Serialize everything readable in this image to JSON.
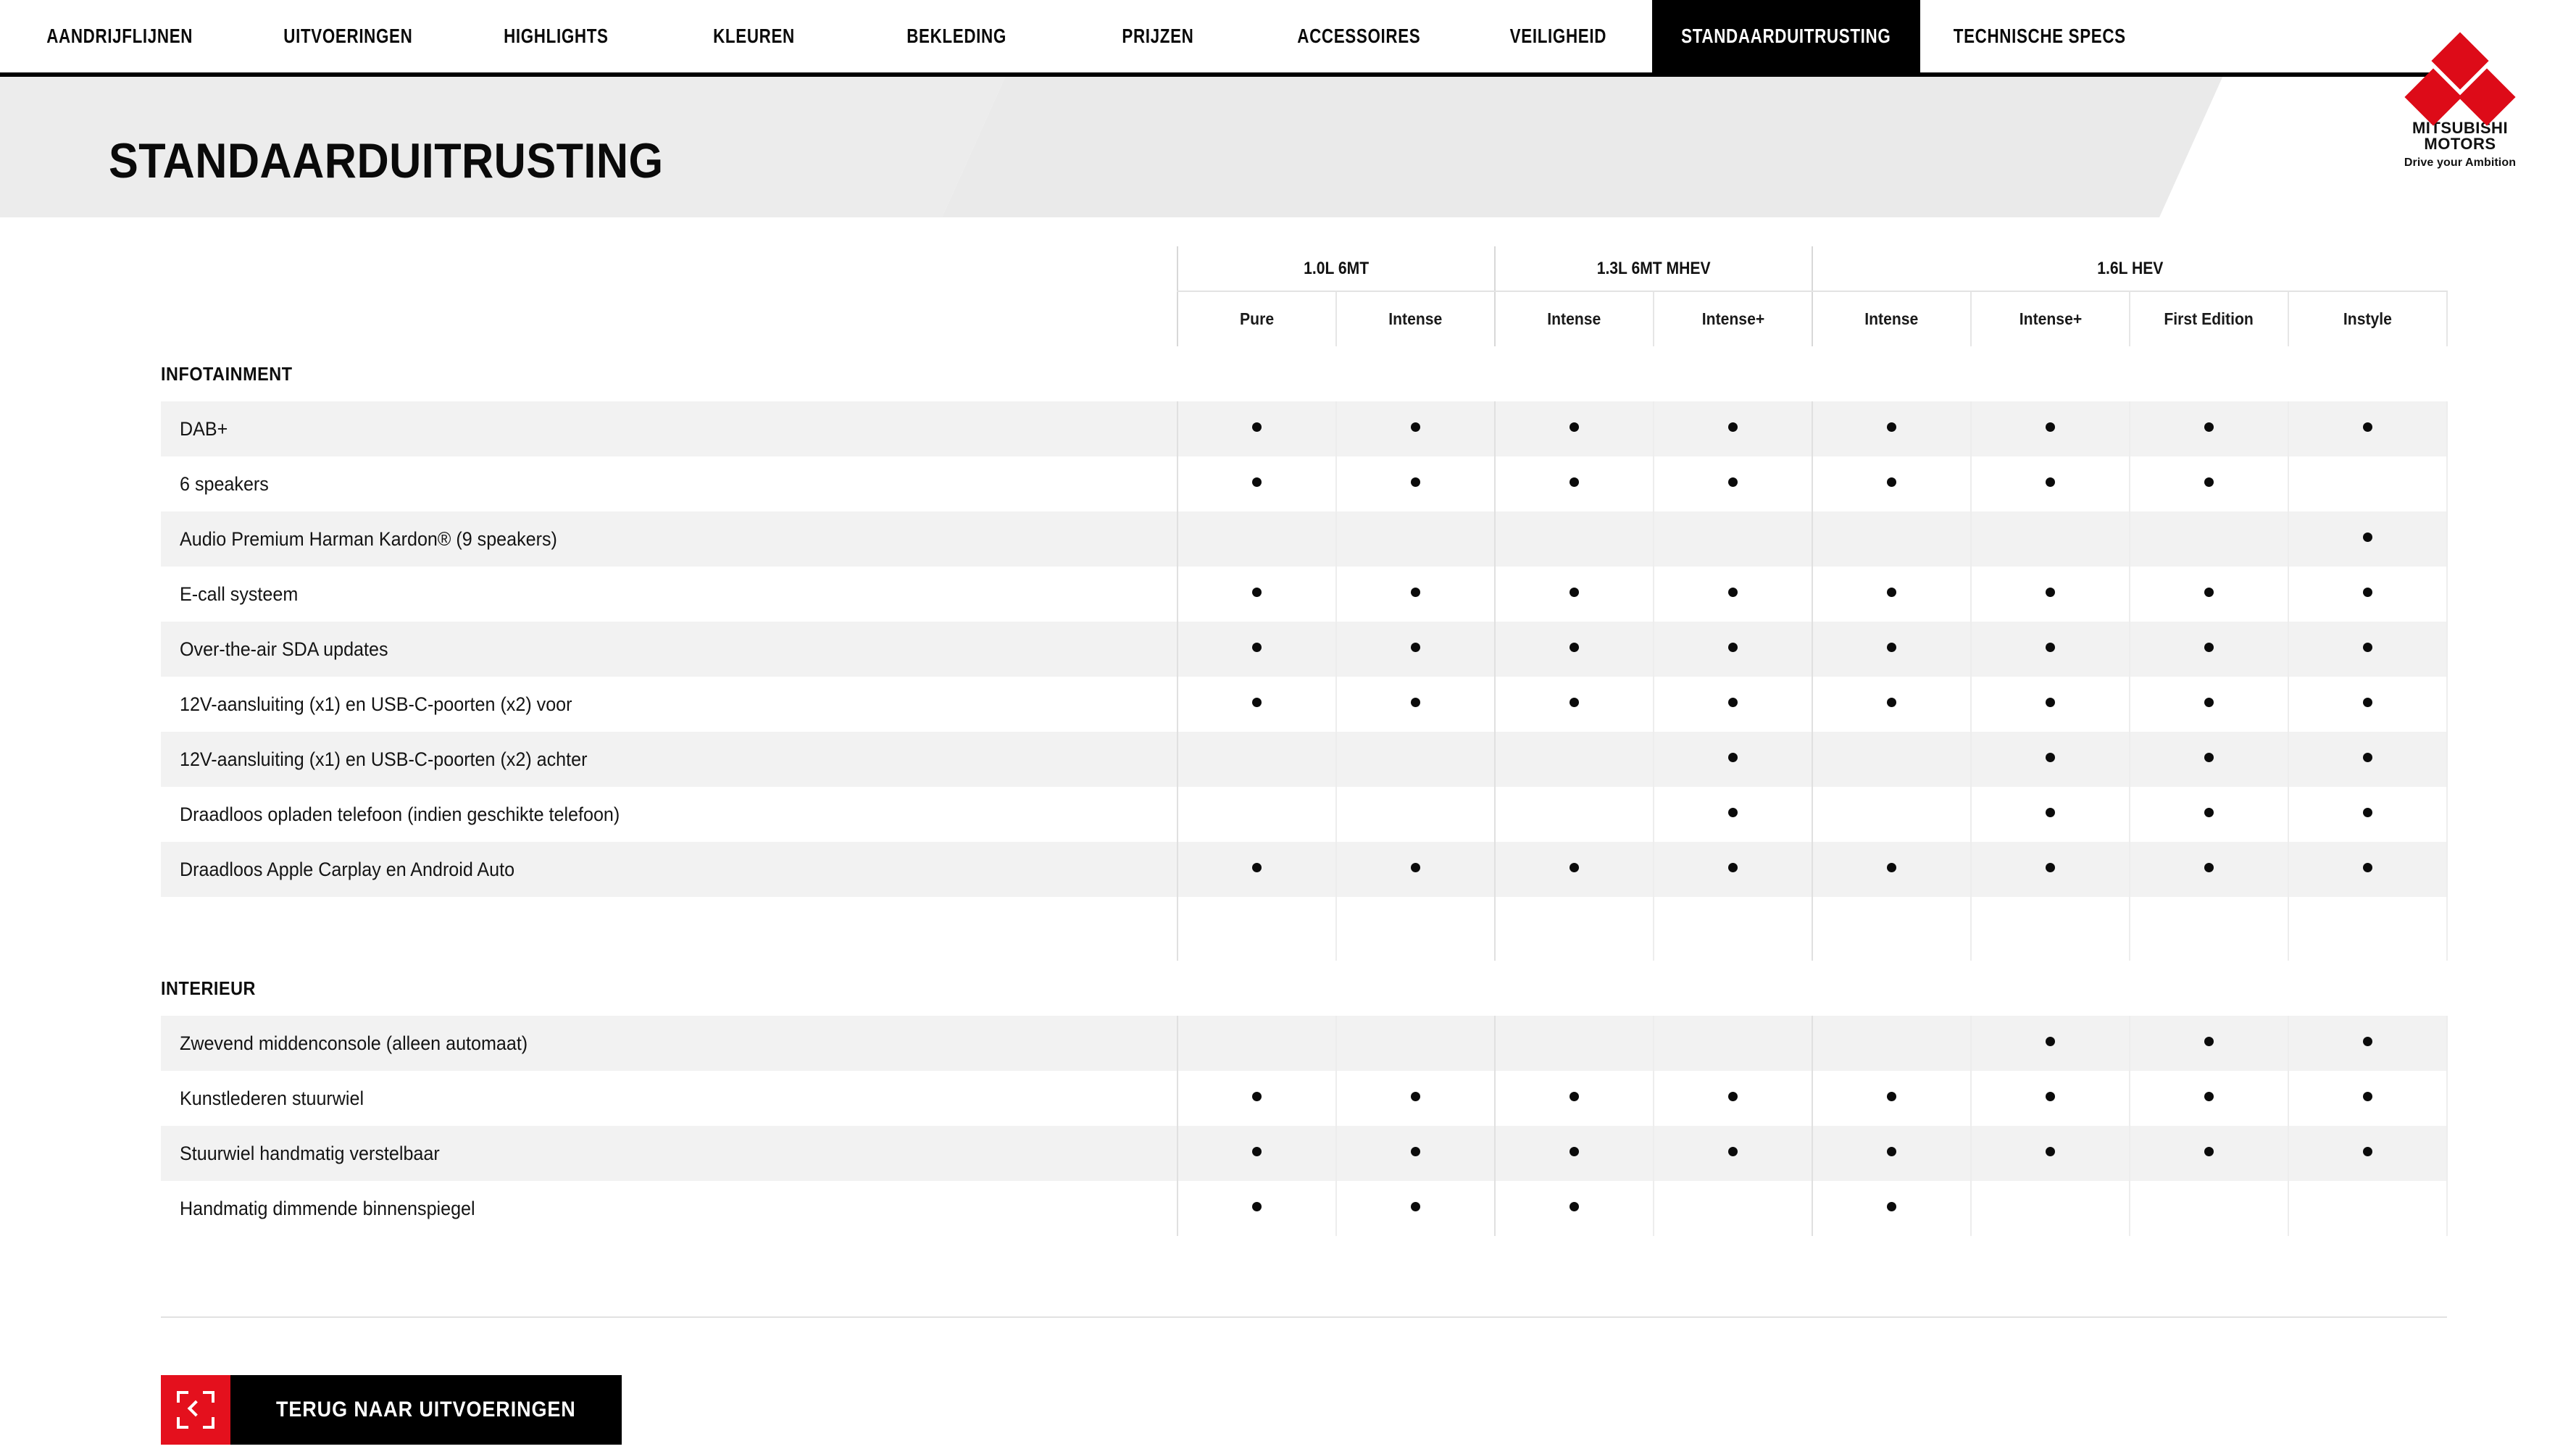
{
  "nav": {
    "items": [
      {
        "label": "AANDRIJFLIJNEN",
        "active": false
      },
      {
        "label": "UITVOERINGEN",
        "active": false
      },
      {
        "label": "HIGHLIGHTS",
        "active": false
      },
      {
        "label": "KLEUREN",
        "active": false
      },
      {
        "label": "BEKLEDING",
        "active": false
      },
      {
        "label": "PRIJZEN",
        "active": false
      },
      {
        "label": "ACCESSOIRES",
        "active": false
      },
      {
        "label": "VEILIGHEID",
        "active": false
      },
      {
        "label": "STANDAARDUITRUSTING",
        "active": true
      },
      {
        "label": "TECHNISCHE SPECS",
        "active": false
      }
    ]
  },
  "brand": {
    "name_line1": "MITSUBISHI",
    "name_line2": "MOTORS",
    "tagline": "Drive your Ambition",
    "accent_color": "#dd0b18"
  },
  "header": {
    "title": "STANDAARDUITRUSTING"
  },
  "table": {
    "engine_groups": [
      {
        "label": "1.0L 6MT",
        "span": 2
      },
      {
        "label": "1.3L 6MT MHEV",
        "span": 2
      },
      {
        "label": "1.6L HEV",
        "span": 4
      }
    ],
    "trims": [
      "Pure",
      "Intense",
      "Intense",
      "Intense+",
      "Intense",
      "Intense+",
      "First Edition",
      "Instyle"
    ],
    "sections": [
      {
        "title": "INFOTAINMENT",
        "rows": [
          {
            "label": "DAB+",
            "values": [
              true,
              true,
              true,
              true,
              true,
              true,
              true,
              true
            ]
          },
          {
            "label": "6 speakers",
            "values": [
              true,
              true,
              true,
              true,
              true,
              true,
              true,
              false
            ]
          },
          {
            "label": "Audio Premium Harman Kardon® (9 speakers)",
            "values": [
              false,
              false,
              false,
              false,
              false,
              false,
              false,
              true
            ]
          },
          {
            "label": "E-call systeem",
            "values": [
              true,
              true,
              true,
              true,
              true,
              true,
              true,
              true
            ]
          },
          {
            "label": "Over-the-air SDA updates",
            "values": [
              true,
              true,
              true,
              true,
              true,
              true,
              true,
              true
            ]
          },
          {
            "label": "12V-aansluiting (x1) en USB-C-poorten (x2) voor",
            "values": [
              true,
              true,
              true,
              true,
              true,
              true,
              true,
              true
            ]
          },
          {
            "label": "12V-aansluiting (x1) en USB-C-poorten (x2) achter",
            "values": [
              false,
              false,
              false,
              true,
              false,
              true,
              true,
              true
            ]
          },
          {
            "label": "Draadloos opladen telefoon (indien geschikte telefoon)",
            "values": [
              false,
              false,
              false,
              true,
              false,
              true,
              true,
              true
            ]
          },
          {
            "label": "Draadloos Apple Carplay en Android Auto",
            "values": [
              true,
              true,
              true,
              true,
              true,
              true,
              true,
              true
            ]
          }
        ]
      },
      {
        "title": "INTERIEUR",
        "rows": [
          {
            "label": "Zwevend middenconsole (alleen automaat)",
            "values": [
              false,
              false,
              false,
              false,
              false,
              true,
              true,
              true
            ]
          },
          {
            "label": "Kunstlederen stuurwiel",
            "values": [
              true,
              true,
              true,
              true,
              true,
              true,
              true,
              true
            ]
          },
          {
            "label": "Stuurwiel handmatig verstelbaar",
            "values": [
              true,
              true,
              true,
              true,
              true,
              true,
              true,
              true
            ]
          },
          {
            "label": "Handmatig dimmende binnenspiegel",
            "values": [
              true,
              true,
              true,
              false,
              true,
              false,
              false,
              false
            ]
          }
        ]
      }
    ]
  },
  "footer": {
    "back_button_label": "TERUG NAAR UITVOERINGEN",
    "back_button_icon": "fullscreen-back-icon",
    "back_button_accent": "#e4101d"
  }
}
